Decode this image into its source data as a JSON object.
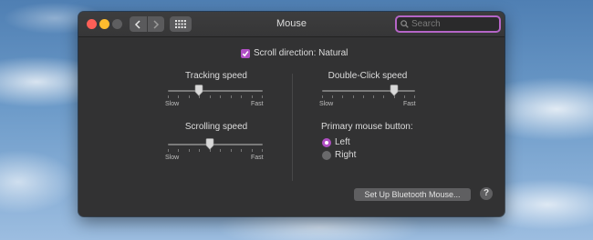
{
  "window": {
    "title": "Mouse",
    "search": {
      "placeholder": "Search",
      "value": ""
    },
    "traffic_lights": [
      "close",
      "minimize",
      "zoom"
    ],
    "nav": {
      "back_icon": "chevron-left-icon",
      "forward_icon": "chevron-right-icon",
      "grid_icon": "grid-icon"
    }
  },
  "scroll_direction": {
    "label": "Scroll direction: Natural",
    "checked": true
  },
  "tracking_speed": {
    "label": "Tracking speed",
    "min_label": "Slow",
    "max_label": "Fast",
    "value": 0.33
  },
  "scrolling_speed": {
    "label": "Scrolling speed",
    "min_label": "Slow",
    "max_label": "Fast",
    "value": 0.44
  },
  "double_click_speed": {
    "label": "Double-Click speed",
    "min_label": "Slow",
    "max_label": "Fast",
    "value": 0.77
  },
  "primary_button": {
    "label": "Primary mouse button:",
    "options": [
      {
        "label": "Left",
        "selected": true
      },
      {
        "label": "Right",
        "selected": false
      }
    ]
  },
  "bluetooth_button": {
    "label": "Set Up Bluetooth Mouse..."
  },
  "help_button": {
    "label": "?"
  },
  "colors": {
    "accent": "#b04fc4",
    "window_bg": "#323233",
    "text": "#dcdcdc"
  }
}
